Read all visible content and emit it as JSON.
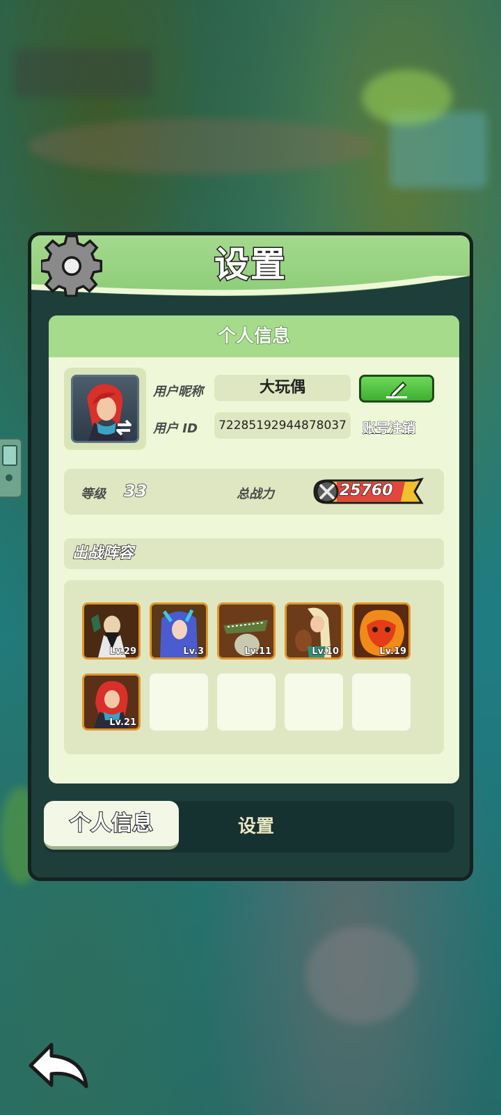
{
  "title": "设置",
  "card_header": "个人信息",
  "profile": {
    "nickname_label": "用户昵称",
    "nickname": "大玩偶",
    "id_label": "用户 ID",
    "id_value": "72285192944878037",
    "deregister_link": "账号注销"
  },
  "stats": {
    "level_label": "等级",
    "level": "33",
    "power_label": "总战力",
    "power": "25760"
  },
  "lineup": {
    "title": "出战阵容",
    "heroes": [
      {
        "level": "Lv.29"
      },
      {
        "level": "Lv.3"
      },
      {
        "level": "Lv.11"
      },
      {
        "level": "Lv.10"
      },
      {
        "level": "Lv.19"
      },
      {
        "level": "Lv.21"
      }
    ],
    "empty_slots": 4
  },
  "tabs": [
    {
      "label": "个人信息",
      "active": true
    },
    {
      "label": "设置",
      "active": false
    }
  ],
  "icons": {
    "header": "gear-icon",
    "edit": "pencil-icon",
    "avatar_swap": "swap-icon",
    "power": "crossed-swords-icon",
    "back": "back-arrow-icon"
  },
  "colors": {
    "header_green": "#8bcb76",
    "card_bg": "#eef7d8",
    "edit_button": "#3fae33",
    "slot_border": "#e0962a"
  }
}
